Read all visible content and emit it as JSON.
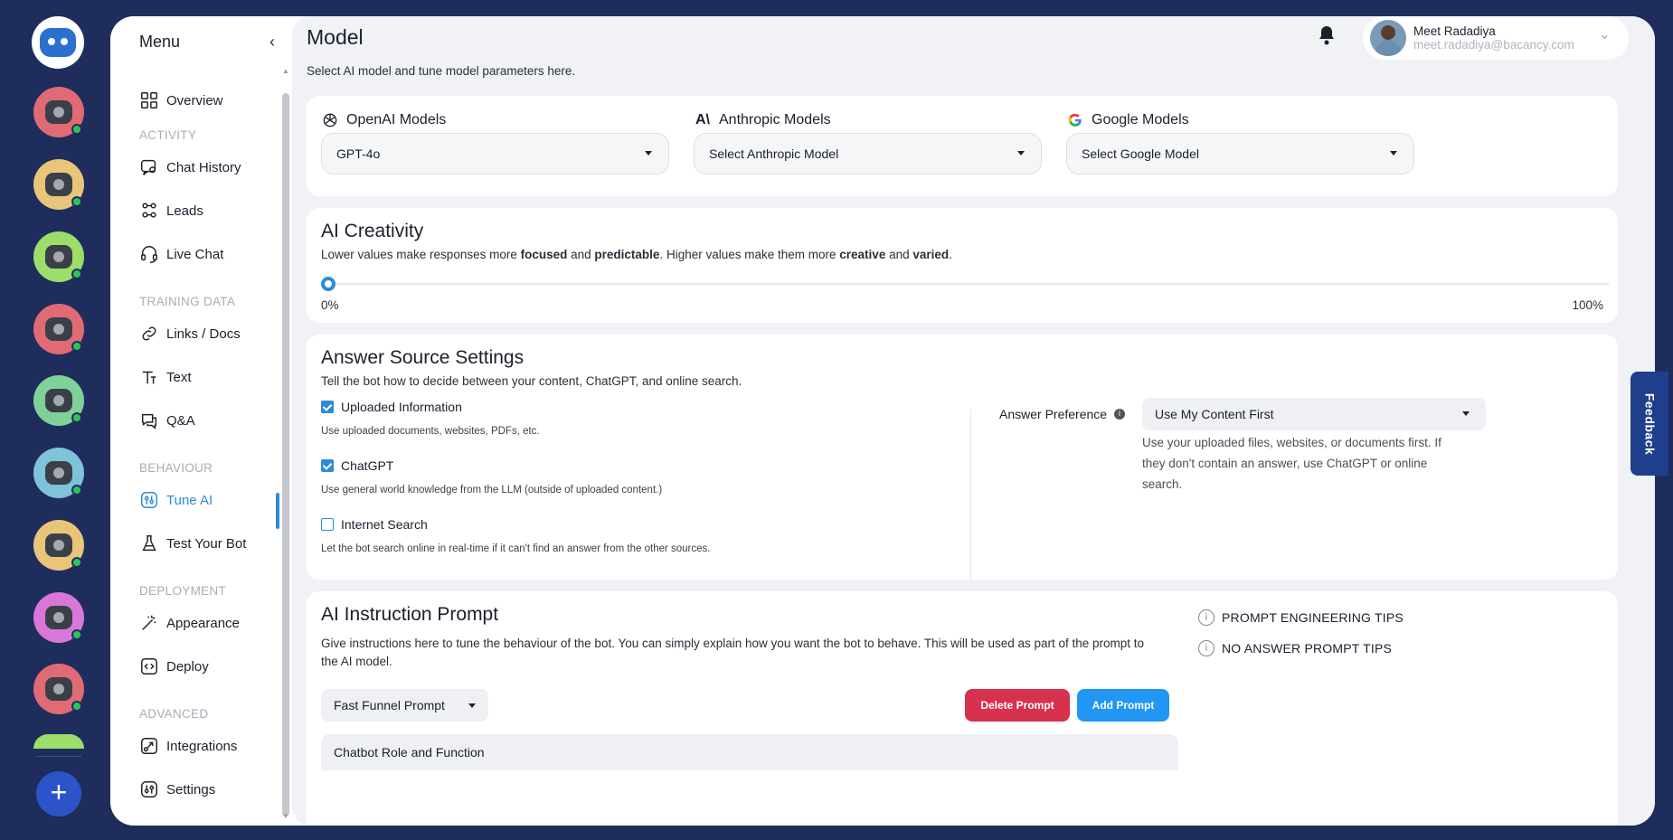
{
  "menu": {
    "title": "Menu",
    "items": {
      "overview": "Overview",
      "chat_history": "Chat History",
      "leads": "Leads",
      "live_chat": "Live Chat",
      "links_docs": "Links / Docs",
      "text": "Text",
      "qa": "Q&A",
      "tune_ai": "Tune AI",
      "test_your_bot": "Test Your Bot",
      "appearance": "Appearance",
      "deploy": "Deploy",
      "integrations": "Integrations",
      "settings": "Settings"
    },
    "sections": {
      "activity": "ACTIVITY",
      "training_data": "TRAINING DATA",
      "behaviour": "BEHAVIOUR",
      "deployment": "DEPLOYMENT",
      "advanced": "ADVANCED"
    },
    "active_item": "Tune AI"
  },
  "header": {
    "title": "Model",
    "subtitle": "Select AI model and tune model parameters here.",
    "user_name": "Meet Radadiya",
    "user_email": "meet.radadiya@bacancy.com"
  },
  "models": {
    "openai": {
      "label": "OpenAI Models",
      "value": "GPT-4o"
    },
    "anthropic": {
      "label": "Anthropic Models",
      "value": "Select Anthropic Model"
    },
    "google": {
      "label": "Google Models",
      "value": "Select Google Model"
    }
  },
  "creativity": {
    "title": "AI Creativity",
    "desc_1": "Lower values make responses more ",
    "desc_b1": "focused",
    "desc_2": " and ",
    "desc_b2": "predictable",
    "desc_3": ". Higher values make them more ",
    "desc_b3": "creative",
    "desc_4": " and ",
    "desc_b4": "varied",
    "desc_5": ".",
    "value_percent": 0,
    "min_label": "0%",
    "max_label": "100%"
  },
  "answer_source": {
    "title": "Answer Source Settings",
    "subtitle": "Tell the bot how to decide between your content, ChatGPT, and online search.",
    "options": [
      {
        "label": "Uploaded Information",
        "desc": "Use uploaded documents, websites, PDFs, etc.",
        "checked": true
      },
      {
        "label": "ChatGPT",
        "desc": "Use general world knowledge from the LLM (outside of uploaded content.)",
        "checked": true
      },
      {
        "label": "Internet Search",
        "desc": "Let the bot search online in real-time if it can't find an answer from the other sources.",
        "checked": false
      }
    ],
    "preference_label": "Answer Preference",
    "preference_value": "Use My Content First",
    "preference_help": "Use your uploaded files, websites, or documents first. If they don't contain an answer, use ChatGPT or online search."
  },
  "instruction": {
    "title": "AI Instruction Prompt",
    "desc": "Give instructions here to tune the behaviour of the bot. You can simply explain how you want the bot to behave. This will be used as part of the prompt to the AI model.",
    "prompt_select": "Fast Funnel Prompt",
    "delete_label": "Delete Prompt",
    "add_label": "Add Prompt",
    "prompt_text": "Chatbot Role and Function",
    "tip_1": "PROMPT ENGINEERING TIPS",
    "tip_2": "NO ANSWER PROMPT TIPS"
  },
  "feedback_label": "Feedback",
  "colors": {
    "rail": "#1f2d5c",
    "accent": "#2d8bd8",
    "delete": "#d6314f",
    "add": "#2196f3",
    "bot_colors": [
      "#e06b74",
      "#e9c57a",
      "#9bde6a",
      "#e06b74",
      "#7fd19a",
      "#7ec3d9",
      "#e9c57a",
      "#d977d9",
      "#e06b74",
      "#9bde6a"
    ]
  },
  "icons": [
    "robot-logo-icon",
    "bell-icon",
    "chevron-left-icon",
    "chevron-down-icon",
    "plus-icon",
    "info-icon"
  ]
}
